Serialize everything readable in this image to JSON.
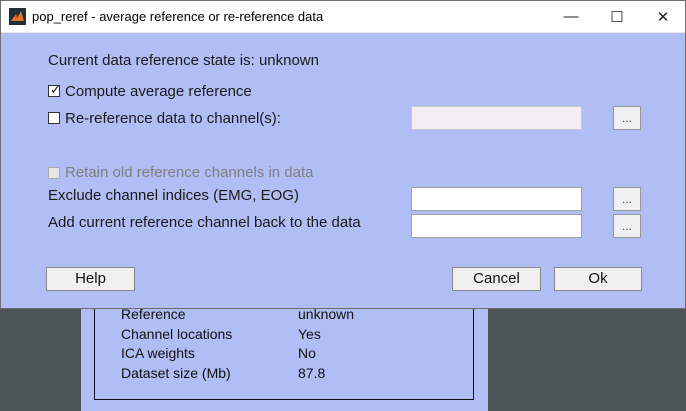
{
  "window": {
    "title": "pop_reref - average reference or re-reference data",
    "minimize_glyph": "—",
    "maximize_glyph": "☐",
    "close_glyph": "✕"
  },
  "dialog": {
    "state_label": "Current data reference state is: unknown",
    "compute_avg": {
      "label": "Compute average reference",
      "checked": true
    },
    "reref": {
      "label": "Re-reference data to channel(s):",
      "checked": false,
      "value": ""
    },
    "retain": {
      "label": "Retain old reference channels in data",
      "checked": false,
      "enabled": false
    },
    "exclude": {
      "label": "Exclude channel indices (EMG, EOG)",
      "value": ""
    },
    "addref": {
      "label": "Add current reference channel back to the data",
      "value": ""
    },
    "browse_label": "...",
    "help_label": "Help",
    "cancel_label": "Cancel",
    "ok_label": "Ok"
  },
  "background_info": {
    "rows": [
      {
        "key": "Reference",
        "value": "unknown"
      },
      {
        "key": "Channel locations",
        "value": "Yes"
      },
      {
        "key": "ICA weights",
        "value": "No"
      },
      {
        "key": "Dataset size (Mb)",
        "value": "87.8"
      }
    ]
  },
  "colors": {
    "dialog_bg": "#b0bef5",
    "desktop_bg": "#4a5456"
  }
}
